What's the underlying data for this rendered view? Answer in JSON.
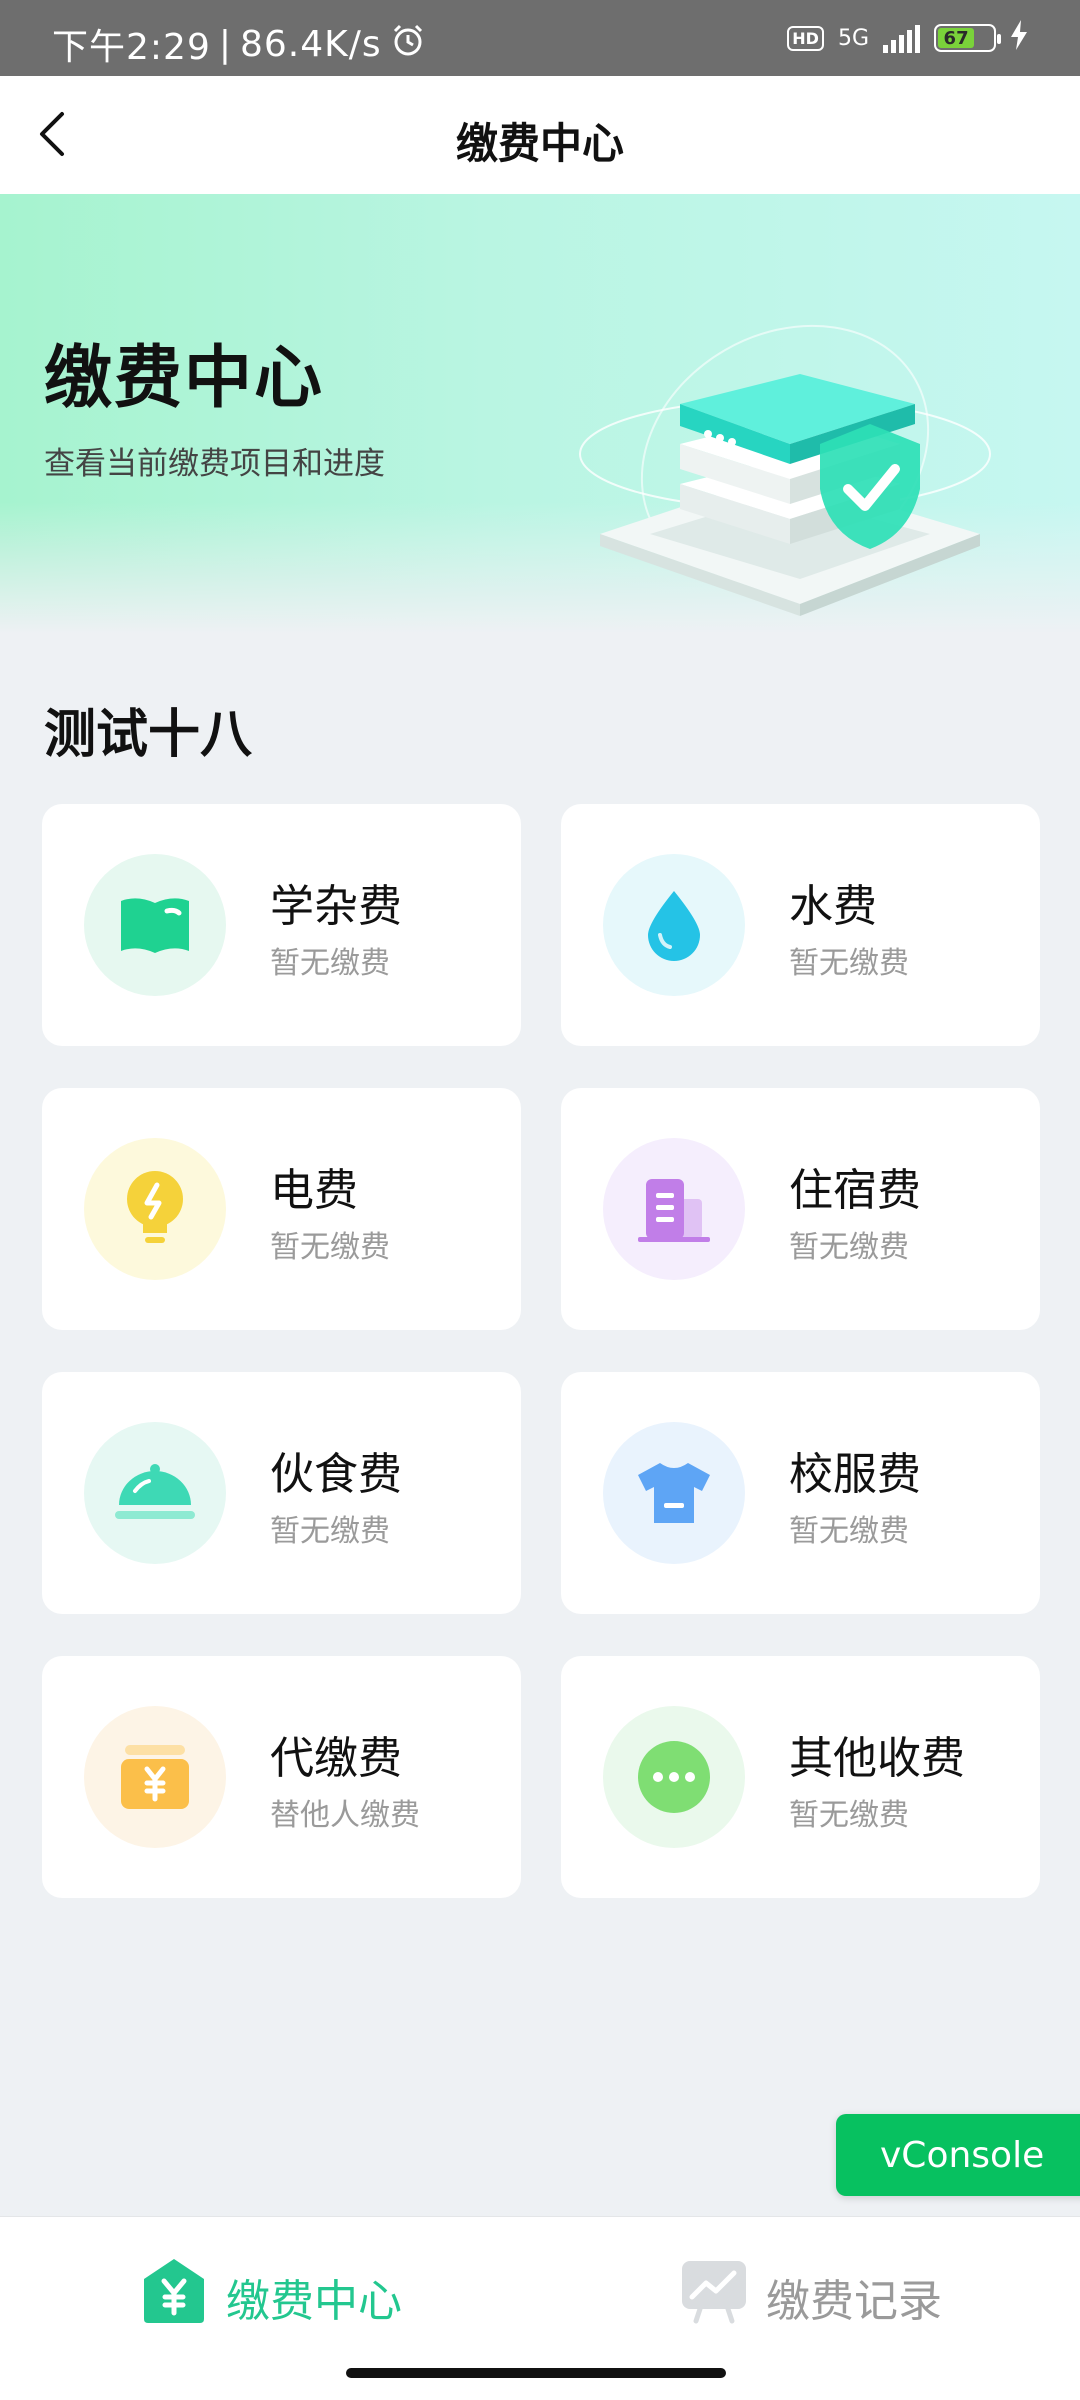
{
  "status_bar": {
    "time": "下午2:29",
    "net_speed": "86.4K/s",
    "hd": "HD",
    "network": "5G",
    "battery": "67"
  },
  "nav": {
    "title": "缴费中心"
  },
  "banner": {
    "title": "缴费中心",
    "subtitle": "查看当前缴费项目和进度"
  },
  "section": {
    "title": "测试十八"
  },
  "fees": [
    {
      "name": "学杂费",
      "desc": "暂无缴费",
      "icon": "book-icon",
      "icon_bg": "#e6f8f0",
      "icon_color": "#1fd291"
    },
    {
      "name": "水费",
      "desc": "暂无缴费",
      "icon": "water-drop-icon",
      "icon_bg": "#e6f8fb",
      "icon_color": "#25c3e6"
    },
    {
      "name": "电费",
      "desc": "暂无缴费",
      "icon": "lightbulb-icon",
      "icon_bg": "#fdf9dc",
      "icon_color": "#f5d23a"
    },
    {
      "name": "住宿费",
      "desc": "暂无缴费",
      "icon": "building-icon",
      "icon_bg": "#f5eefd",
      "icon_color": "#c17ee8"
    },
    {
      "name": "伙食费",
      "desc": "暂无缴费",
      "icon": "food-cloche-icon",
      "icon_bg": "#e6f8f3",
      "icon_color": "#3ed9b5"
    },
    {
      "name": "校服费",
      "desc": "暂无缴费",
      "icon": "shirt-icon",
      "icon_bg": "#e9f3fd",
      "icon_color": "#5ea5f5"
    },
    {
      "name": "代缴费",
      "desc": "替他人缴费",
      "icon": "yen-card-icon",
      "icon_bg": "#fdf4e6",
      "icon_color": "#fbbf4a"
    },
    {
      "name": "其他收费",
      "desc": "暂无缴费",
      "icon": "more-dots-icon",
      "icon_bg": "#eaf9ec",
      "icon_color": "#7fde73"
    }
  ],
  "vconsole": {
    "label": "vConsole"
  },
  "tabs": [
    {
      "label": "缴费中心",
      "icon": "yen-home-icon",
      "active": true
    },
    {
      "label": "缴费记录",
      "icon": "chart-record-icon",
      "active": false
    }
  ],
  "colors": {
    "accent": "#23c78f",
    "vconsole": "#07c160"
  }
}
